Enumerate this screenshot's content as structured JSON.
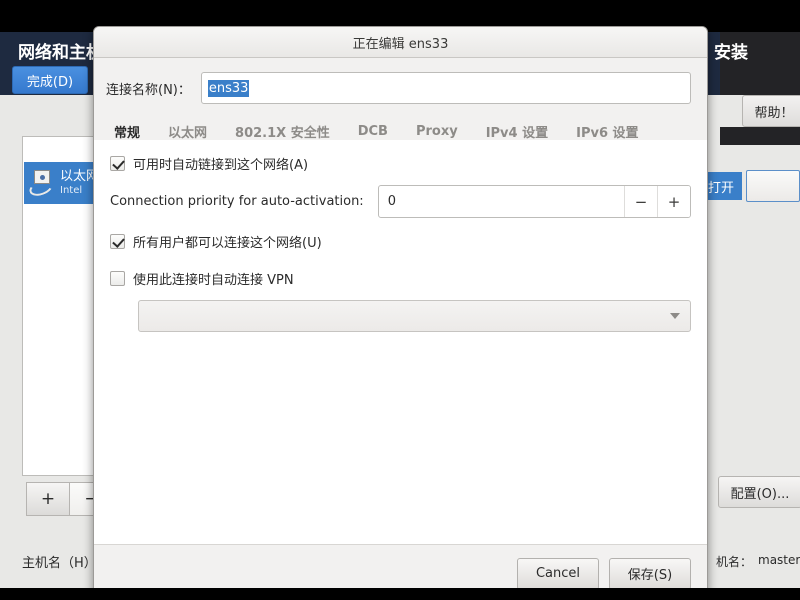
{
  "background_window": {
    "title_left": "网络和主机",
    "title_right": "安装",
    "done_button": "完成(D)",
    "help_button": "帮助！",
    "open_chip": "打开",
    "device_list": [
      {
        "title": "以太网",
        "subtitle": "Intel"
      }
    ],
    "add_button": "+",
    "remove_button": "−",
    "hostname_label": "主机名（H）",
    "configure_button": "配置(O)...",
    "current_hostname_label": "机名：",
    "current_hostname_value": "master"
  },
  "dialog": {
    "title": "正在编辑 ens33",
    "connection_name_label": "连接名称(N)：",
    "connection_name_value": "ens33",
    "tabs": [
      {
        "label": "常规",
        "active": true
      },
      {
        "label": "以太网",
        "active": false
      },
      {
        "label": "802.1X 安全性",
        "active": false
      },
      {
        "label": "DCB",
        "active": false
      },
      {
        "label": "Proxy",
        "active": false
      },
      {
        "label": "IPv4 设置",
        "active": false
      },
      {
        "label": "IPv6 设置",
        "active": false
      }
    ],
    "general": {
      "autoconnect_label": "可用时自动链接到这个网络(A)",
      "autoconnect_checked": true,
      "priority_label": "Connection priority for auto-activation:",
      "priority_value": "0",
      "priority_decrement": "−",
      "priority_increment": "+",
      "all_users_label": "所有用户都可以连接这个网络(U)",
      "all_users_checked": true,
      "vpn_label": "使用此连接时自动连接 VPN",
      "vpn_checked": false,
      "vpn_select_value": ""
    },
    "cancel_button": "Cancel",
    "save_button": "保存(S)"
  },
  "colors": {
    "accent_blue": "#3a7fc9",
    "tab_underline": "#4a90d9",
    "header_navy": "#1e2a40",
    "header_dark": "#232326",
    "dialog_bg": "#f2f1f0"
  }
}
